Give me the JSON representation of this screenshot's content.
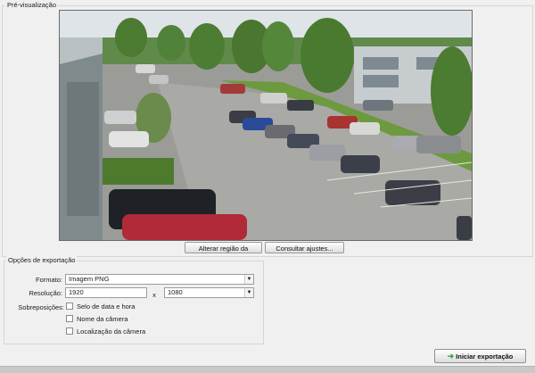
{
  "preview": {
    "title": "Pré-visualização",
    "change_region_label": "Alterar região da",
    "settings_label": "Consultar ajustes..."
  },
  "export_options": {
    "title": "Opções de exportação",
    "format_label": "Formato:",
    "format_value": "Imagem PNG",
    "resolution_label": "Resolução:",
    "width_value": "1920",
    "x_separator": "x",
    "height_value": "1080",
    "overlays_label": "Sobreposições:",
    "overlays": [
      {
        "label": "Selo de data e hora",
        "checked": false
      },
      {
        "label": "Nome da câmera",
        "checked": false
      },
      {
        "label": "Localização da câmera",
        "checked": false
      }
    ]
  },
  "start_export_label": "Iniciar exportação",
  "colors": {
    "accent_green": "#3aa53a",
    "panel_background": "#f0f0f0"
  }
}
